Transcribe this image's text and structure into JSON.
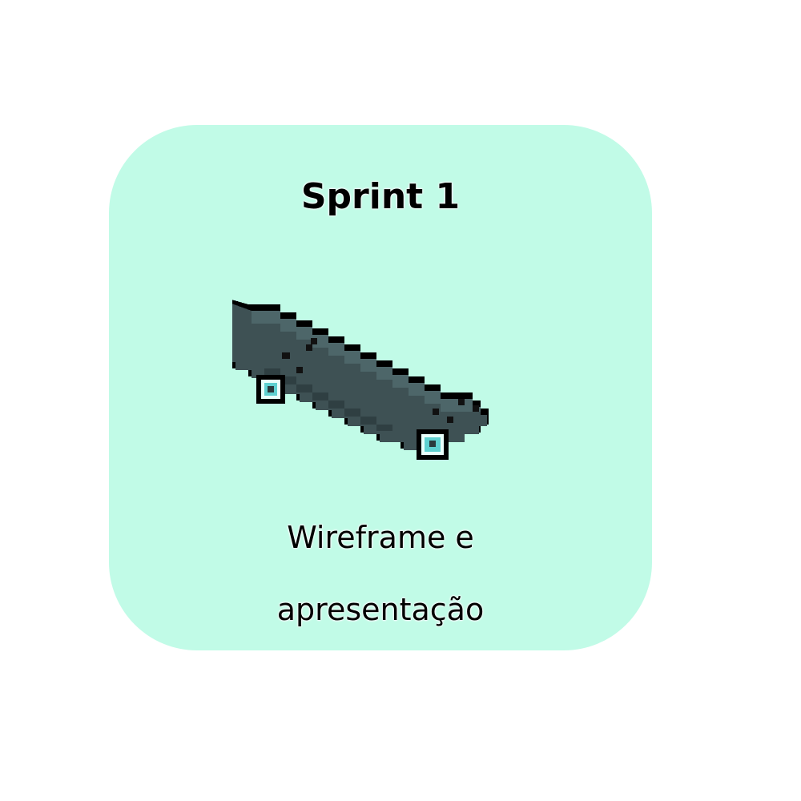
{
  "card": {
    "background_color": "#c1fbe7",
    "title": "Sprint 1",
    "caption_line1": "Wireframe e",
    "caption_line2": "apresentação",
    "illustration_icon": "skateboard-icon"
  },
  "colors": {
    "deck": "#3d4f52",
    "deck_shade": "#2a3a3d",
    "outline": "#000000",
    "wheel": "#5fd0d0"
  }
}
